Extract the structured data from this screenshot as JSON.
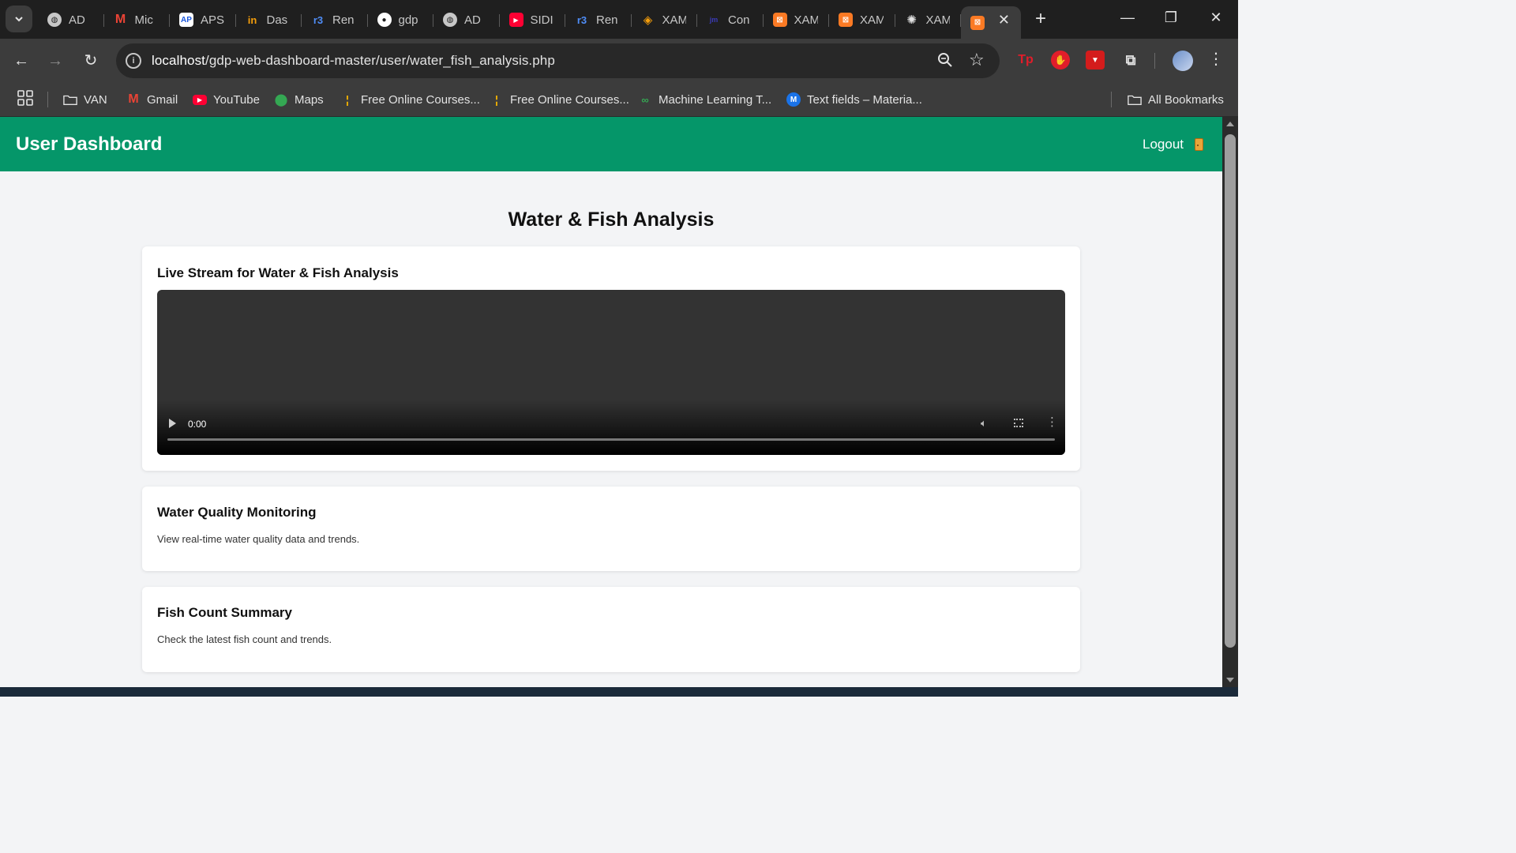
{
  "browser": {
    "tabs": [
      {
        "title": "AD",
        "icon": "globe-icon"
      },
      {
        "title": "Mic",
        "icon": "gmail-icon"
      },
      {
        "title": "APS",
        "icon": "ap-icon"
      },
      {
        "title": "Das",
        "icon": "dashboard-icon"
      },
      {
        "title": "Ren",
        "icon": "render-icon"
      },
      {
        "title": "gdp",
        "icon": "github-icon"
      },
      {
        "title": "AD",
        "icon": "globe-icon"
      },
      {
        "title": "SIDI",
        "icon": "youtube-icon"
      },
      {
        "title": "Ren",
        "icon": "render-icon"
      },
      {
        "title": "XAM",
        "icon": "diamond-icon"
      },
      {
        "title": "Con",
        "icon": "jmp-icon"
      },
      {
        "title": "XAM",
        "icon": "xampp-icon"
      },
      {
        "title": "XAM",
        "icon": "xampp-icon"
      },
      {
        "title": "XAM",
        "icon": "openai-icon"
      }
    ],
    "active_tab_icon": "xampp-icon",
    "address": {
      "host": "localhost",
      "path": "/gdp-web-dashboard-master/user/water_fish_analysis.php"
    },
    "bookmarks": [
      {
        "label": "VAN",
        "icon": "folder-icon"
      },
      {
        "label": "Gmail",
        "icon": "gmail-icon"
      },
      {
        "label": "YouTube",
        "icon": "youtube-icon"
      },
      {
        "label": "Maps",
        "icon": "maps-icon"
      },
      {
        "label": "Free Online Courses...",
        "icon": "courses-icon"
      },
      {
        "label": "Free Online Courses...",
        "icon": "courses-icon"
      },
      {
        "label": "Machine Learning T...",
        "icon": "ml-icon"
      },
      {
        "label": "Text fields – Materia...",
        "icon": "material-icon"
      }
    ],
    "all_bookmarks_label": "All Bookmarks"
  },
  "header": {
    "title": "User Dashboard",
    "logout_label": "Logout"
  },
  "main": {
    "title": "Water & Fish Analysis",
    "livestream": {
      "heading": "Live Stream for Water & Fish Analysis",
      "time": "0:00"
    },
    "cards": [
      {
        "heading": "Water Quality Monitoring",
        "description": "View real-time water quality data and trends."
      },
      {
        "heading": "Fish Count Summary",
        "description": "Check the latest fish count and trends."
      }
    ]
  },
  "colors": {
    "accent": "#059669",
    "page_background": "#f3f4f6",
    "browser_chrome": "#3c3c3c"
  }
}
